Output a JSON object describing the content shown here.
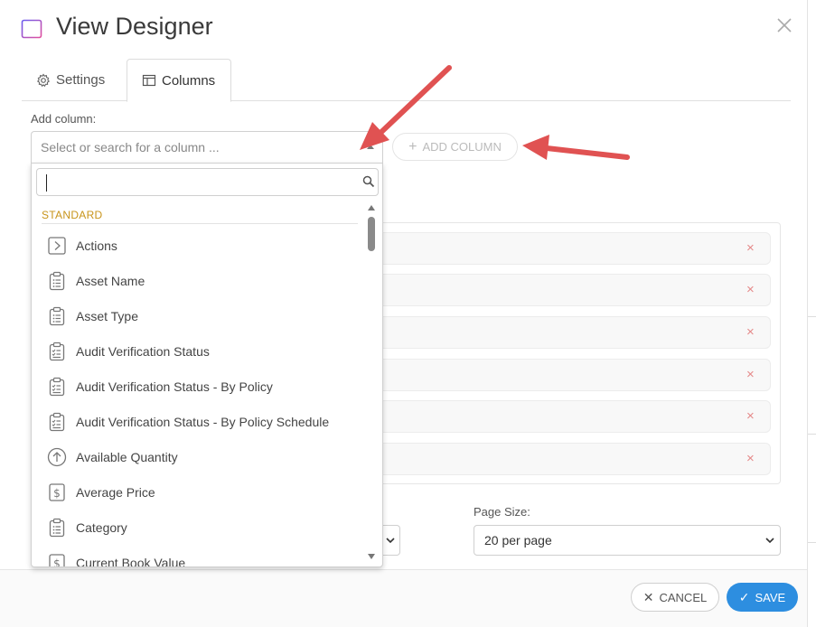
{
  "dialog": {
    "title": "View Designer",
    "close_icon": "close-icon",
    "logo_icon": "view-designer-icon"
  },
  "tabs": [
    {
      "label": "Settings",
      "icon": "gear-icon",
      "active": false
    },
    {
      "label": "Columns",
      "icon": "columns-icon",
      "active": true
    }
  ],
  "add_column": {
    "label": "Add column:",
    "placeholder": "Select or search for a column ...",
    "button_label": "ADD COLUMN",
    "search_value": ""
  },
  "dropdown": {
    "group": "STANDARD",
    "items": [
      {
        "label": "Actions",
        "icon": "play-box-icon"
      },
      {
        "label": "Asset Name",
        "icon": "clipboard-list-icon"
      },
      {
        "label": "Asset Type",
        "icon": "clipboard-list-icon"
      },
      {
        "label": "Audit Verification Status",
        "icon": "clipboard-check-icon"
      },
      {
        "label": "Audit Verification Status - By Policy",
        "icon": "clipboard-check-icon"
      },
      {
        "label": "Audit Verification Status - By Policy Schedule",
        "icon": "clipboard-check-icon"
      },
      {
        "label": "Available Quantity",
        "icon": "arrow-up-circle-icon"
      },
      {
        "label": "Average Price",
        "icon": "dollar-box-icon"
      },
      {
        "label": "Category",
        "icon": "clipboard-list-icon"
      },
      {
        "label": "Current Book Value",
        "icon": "dollar-box-icon"
      }
    ]
  },
  "columns_panel": {
    "remove_glyph": "×",
    "row_count": 6
  },
  "page_size": {
    "label": "Page Size:",
    "value": "20 per page"
  },
  "footer": {
    "cancel_label": "CANCEL",
    "save_label": "SAVE"
  },
  "colors": {
    "accent": "#2d8ee0",
    "group_label": "#c8941a",
    "annotation_arrow": "#e05252",
    "remove_x": "#e58a8a"
  }
}
